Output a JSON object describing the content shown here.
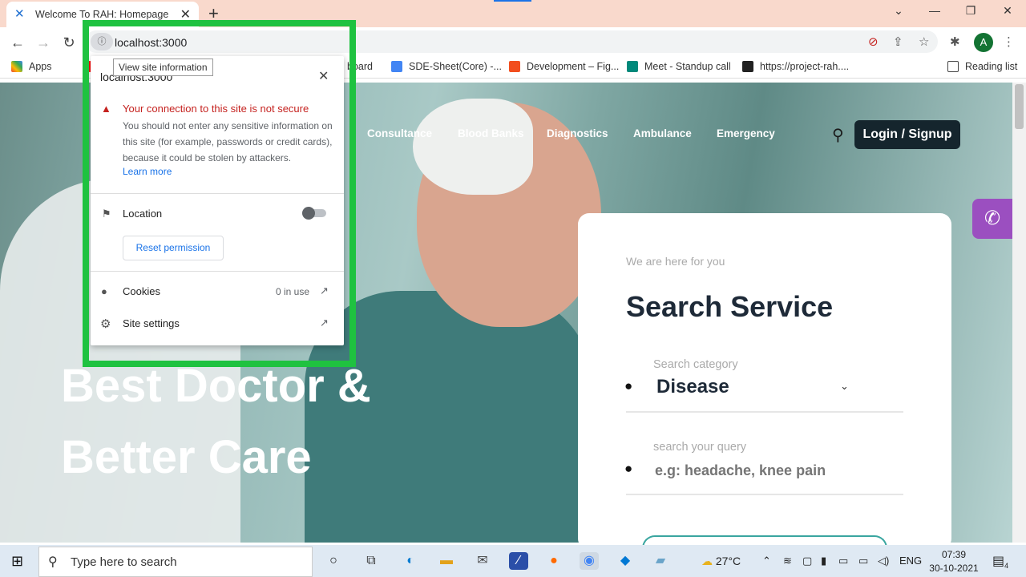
{
  "browser": {
    "tab_title": "Welcome To RAH: Homepage",
    "url": "localhost:3000",
    "profile_initial": "A",
    "bookmarks": [
      "Apps",
      "board",
      "SDE-Sheet(Core) -...",
      "Development – Fig...",
      "Meet - Standup call",
      "https://project-rah....",
      "Reading list"
    ]
  },
  "site_info_popup": {
    "tooltip": "View site information",
    "host": "localhost:3000",
    "warning_title": "Your connection to this site is not secure",
    "warning_body": "You should not enter any sensitive information on this site (for example, passwords or credit cards), because it could be stolen by attackers.",
    "learn_more": "Learn more",
    "location_label": "Location",
    "reset_label": "Reset permission",
    "cookies_label": "Cookies",
    "cookies_use": "0 in use",
    "site_settings_label": "Site settings"
  },
  "site": {
    "nav": [
      "Consultance",
      "Blood Banks",
      "Diagnostics",
      "Ambulance",
      "Emergency"
    ],
    "login_label": "Login / Signup",
    "hero_line1": "Best Doctor &",
    "hero_line2": "Better Care",
    "card": {
      "subtitle": "We are here for you",
      "title": "Search Service",
      "category_label": "Search category",
      "category_value": "Disease",
      "query_label": "search your query",
      "query_placeholder": "e.g: headache, knee pain"
    }
  },
  "taskbar": {
    "search_placeholder": "Type here to search",
    "temperature": "27°C",
    "language": "ENG",
    "time": "07:39",
    "date": "30-10-2021",
    "notification_count": "4"
  },
  "colors": {
    "accent_green_frame": "#1fc240",
    "login_bg": "#15252d",
    "call_button": "#9b4fc0",
    "warning_red": "#c5221f"
  }
}
